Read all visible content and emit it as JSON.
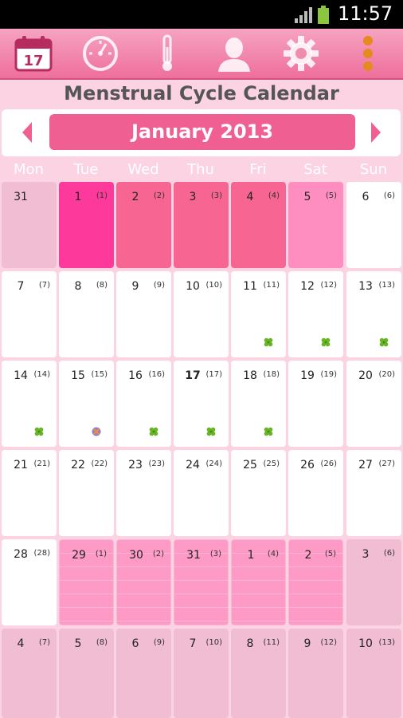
{
  "status_bar": {
    "time": "11:57"
  },
  "toolbar": {
    "calendar_day": "17",
    "icons": [
      "calendar-icon",
      "stopwatch-icon",
      "thermometer-icon",
      "profile-icon",
      "gear-icon",
      "overflow-menu-icon"
    ]
  },
  "title": "Menstrual Cycle Calendar",
  "month": "January 2013",
  "weekdays": [
    "Mon",
    "Tue",
    "Wed",
    "Thu",
    "Fri",
    "Sat",
    "Sun"
  ],
  "colors": {
    "period_heavy": "#fd3a9b",
    "period": "#f76693",
    "period_light": "#ff8ec0",
    "predicted_period": "#fd9ac5",
    "outside_month": "#f0bdd2",
    "normal": "#ffffff",
    "fertile_marker": "#67b526",
    "ovulation_marker": "#8b7fd8"
  },
  "weeks": [
    [
      {
        "day": "31",
        "cycle": "",
        "type": "outside_month"
      },
      {
        "day": "1",
        "cycle": "(1)",
        "type": "period_heavy"
      },
      {
        "day": "2",
        "cycle": "(2)",
        "type": "period"
      },
      {
        "day": "3",
        "cycle": "(3)",
        "type": "period"
      },
      {
        "day": "4",
        "cycle": "(4)",
        "type": "period"
      },
      {
        "day": "5",
        "cycle": "(5)",
        "type": "period_light"
      },
      {
        "day": "6",
        "cycle": "(6)",
        "type": "normal"
      }
    ],
    [
      {
        "day": "7",
        "cycle": "(7)",
        "type": "normal"
      },
      {
        "day": "8",
        "cycle": "(8)",
        "type": "normal"
      },
      {
        "day": "9",
        "cycle": "(9)",
        "type": "normal"
      },
      {
        "day": "10",
        "cycle": "(10)",
        "type": "normal"
      },
      {
        "day": "11",
        "cycle": "(11)",
        "type": "normal",
        "marker": "fertile"
      },
      {
        "day": "12",
        "cycle": "(12)",
        "type": "normal",
        "marker": "fertile"
      },
      {
        "day": "13",
        "cycle": "(13)",
        "type": "normal",
        "marker": "fertile"
      }
    ],
    [
      {
        "day": "14",
        "cycle": "(14)",
        "type": "normal",
        "marker": "fertile"
      },
      {
        "day": "15",
        "cycle": "(15)",
        "type": "normal",
        "marker": "ovulation"
      },
      {
        "day": "16",
        "cycle": "(16)",
        "type": "normal",
        "marker": "fertile"
      },
      {
        "day": "17",
        "cycle": "(17)",
        "type": "normal",
        "marker": "fertile",
        "today": true
      },
      {
        "day": "18",
        "cycle": "(18)",
        "type": "normal",
        "marker": "fertile"
      },
      {
        "day": "19",
        "cycle": "(19)",
        "type": "normal"
      },
      {
        "day": "20",
        "cycle": "(20)",
        "type": "normal"
      }
    ],
    [
      {
        "day": "21",
        "cycle": "(21)",
        "type": "normal"
      },
      {
        "day": "22",
        "cycle": "(22)",
        "type": "normal"
      },
      {
        "day": "23",
        "cycle": "(23)",
        "type": "normal"
      },
      {
        "day": "24",
        "cycle": "(24)",
        "type": "normal"
      },
      {
        "day": "25",
        "cycle": "(25)",
        "type": "normal"
      },
      {
        "day": "26",
        "cycle": "(26)",
        "type": "normal"
      },
      {
        "day": "27",
        "cycle": "(27)",
        "type": "normal"
      }
    ],
    [
      {
        "day": "28",
        "cycle": "(28)",
        "type": "normal"
      },
      {
        "day": "29",
        "cycle": "(1)",
        "type": "predicted_period"
      },
      {
        "day": "30",
        "cycle": "(2)",
        "type": "predicted_period"
      },
      {
        "day": "31",
        "cycle": "(3)",
        "type": "predicted_period"
      },
      {
        "day": "1",
        "cycle": "(4)",
        "type": "predicted_period"
      },
      {
        "day": "2",
        "cycle": "(5)",
        "type": "predicted_period"
      },
      {
        "day": "3",
        "cycle": "(6)",
        "type": "outside_month"
      }
    ],
    [
      {
        "day": "4",
        "cycle": "(7)",
        "type": "outside_month"
      },
      {
        "day": "5",
        "cycle": "(8)",
        "type": "outside_month"
      },
      {
        "day": "6",
        "cycle": "(9)",
        "type": "outside_month"
      },
      {
        "day": "7",
        "cycle": "(10)",
        "type": "outside_month"
      },
      {
        "day": "8",
        "cycle": "(11)",
        "type": "outside_month"
      },
      {
        "day": "9",
        "cycle": "(12)",
        "type": "outside_month"
      },
      {
        "day": "10",
        "cycle": "(13)",
        "type": "outside_month"
      }
    ]
  ]
}
